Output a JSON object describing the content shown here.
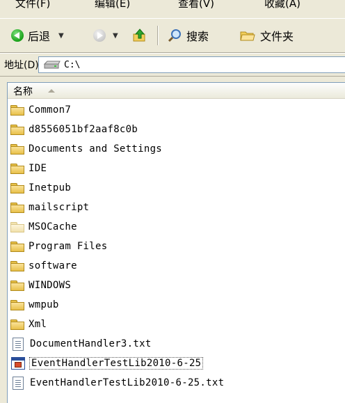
{
  "menu": [
    "文件(F)",
    "编辑(E)",
    "查看(V)",
    "收藏(A)"
  ],
  "toolbar": {
    "back_label": "后退",
    "search_label": "搜索",
    "folders_label": "文件夹"
  },
  "address": {
    "label": "地址(D)",
    "value": "C:\\"
  },
  "list": {
    "column_header": "名称",
    "items": [
      {
        "name": "Common7",
        "type": "folder"
      },
      {
        "name": "d8556051bf2aaf8c0b",
        "type": "folder"
      },
      {
        "name": "Documents and Settings",
        "type": "folder"
      },
      {
        "name": "IDE",
        "type": "folder"
      },
      {
        "name": "Inetpub",
        "type": "folder"
      },
      {
        "name": "mailscript",
        "type": "folder"
      },
      {
        "name": "MSOCache",
        "type": "folder-hidden"
      },
      {
        "name": "Program Files",
        "type": "folder"
      },
      {
        "name": "software",
        "type": "folder"
      },
      {
        "name": "WINDOWS",
        "type": "folder"
      },
      {
        "name": "wmpub",
        "type": "folder"
      },
      {
        "name": "Xml",
        "type": "folder"
      },
      {
        "name": "DocumentHandler3.txt",
        "type": "text-file"
      },
      {
        "name": "EventHandlerTestLib2010-6-25",
        "type": "app-file"
      },
      {
        "name": "EventHandlerTestLib2010-6-25.txt",
        "type": "text-file"
      }
    ]
  }
}
